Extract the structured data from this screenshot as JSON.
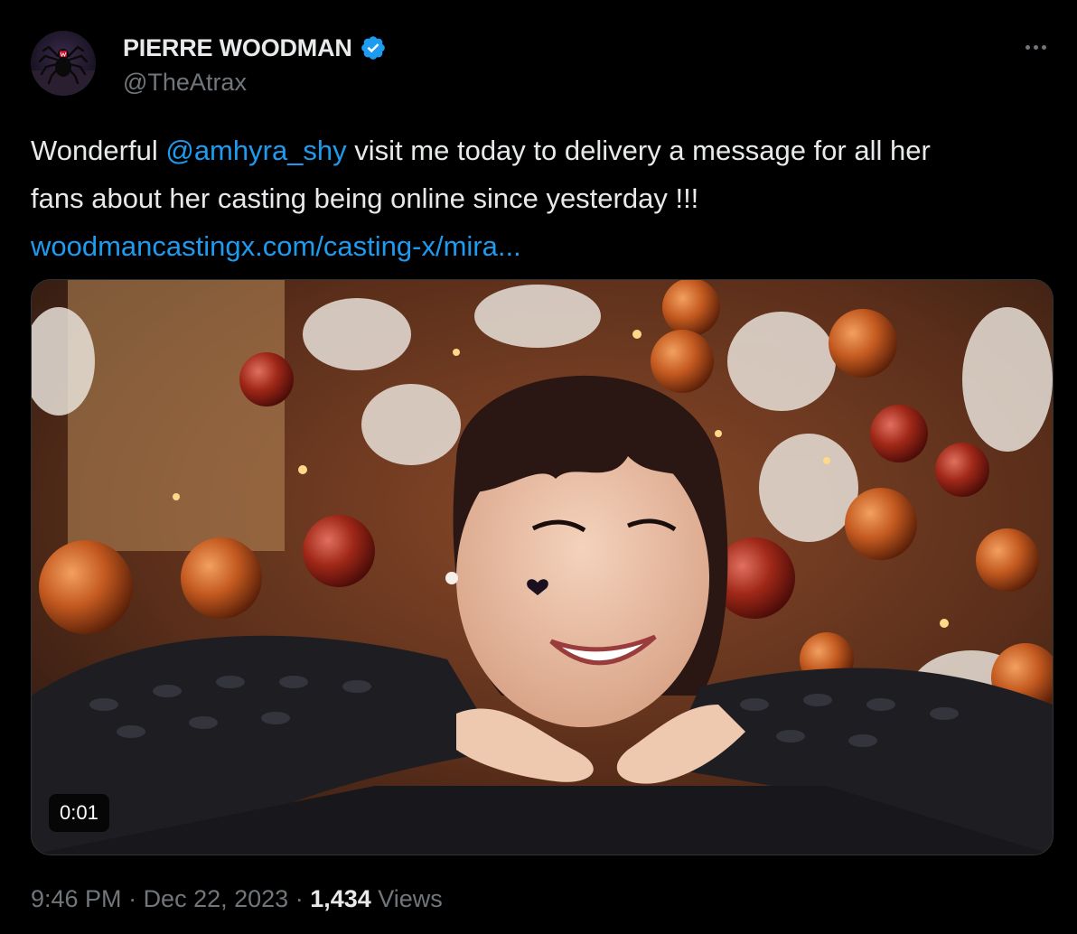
{
  "author": {
    "display_name": "PIERRE WOODMAN",
    "handle": "@TheAtrax",
    "verified": true,
    "avatar_icon": "spider-logo-icon"
  },
  "tweet": {
    "line1_prefix": "Wonderful ",
    "mention": "@amhyra_shy",
    "line1_suffix": " visit me today to delivery a message for all her",
    "line2": "fans about her casting being online since yesterday !!!",
    "link": "woodmancastingx.com/casting-x/mira..."
  },
  "media": {
    "type": "video",
    "duration": "0:01"
  },
  "meta": {
    "time": "9:46 PM",
    "sep1": " · ",
    "date": "Dec 22, 2023",
    "sep2": " · ",
    "views_count": "1,434",
    "views_label": " Views"
  },
  "colors": {
    "background": "#000000",
    "text": "#e7e9ea",
    "secondary": "#71767b",
    "accent": "#1d9bf0"
  }
}
